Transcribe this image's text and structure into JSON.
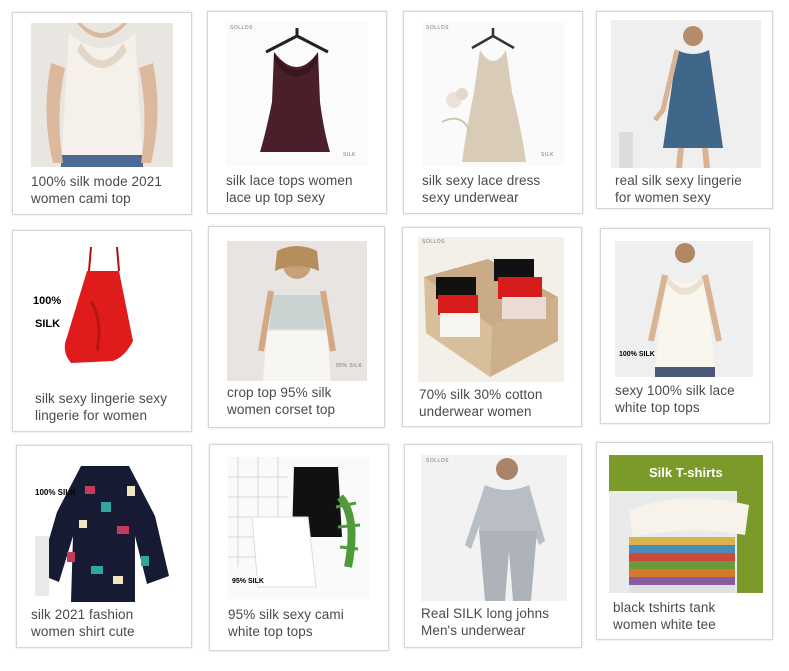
{
  "products": [
    {
      "caption": "100% silk mode 2021\nwomen cami top"
    },
    {
      "caption": "silk lace tops women\nlace up top sexy",
      "brand": "SOLLOS",
      "tag": "SILK"
    },
    {
      "caption": "silk sexy lace dress\nsexy underwear",
      "brand": "SOLLOS",
      "tag": "SILK"
    },
    {
      "caption": "real silk sexy lingerie\nfor women sexy"
    },
    {
      "caption": "silk sexy lingerie sexy\nlingerie for women",
      "overlay_line1": "100%",
      "overlay_line2": "SILK"
    },
    {
      "caption": "crop top 95% silk\nwomen corset top",
      "tag": "95% SILK"
    },
    {
      "caption": "70% silk 30% cotton\nunderwear women",
      "brand": "SOLLOS"
    },
    {
      "caption": "sexy 100% silk lace\nwhite top tops",
      "overlay": "100% SILK"
    },
    {
      "caption": "silk 2021 fashion\nwomen shirt cute",
      "overlay": "100% SILK"
    },
    {
      "caption": "95% silk sexy cami\nwhite top tops",
      "overlay": "95% SILK"
    },
    {
      "caption": "Real SILK long johns\nMen's underwear",
      "brand": "SOLLOS"
    },
    {
      "caption": "black tshirts tank\nwomen  white tee",
      "overlay": "Silk T-shirts"
    }
  ],
  "colors": {
    "card_border": "#d6d6d6",
    "caption_text": "#4a4a4a",
    "banner_green": "#7a9a2a"
  }
}
